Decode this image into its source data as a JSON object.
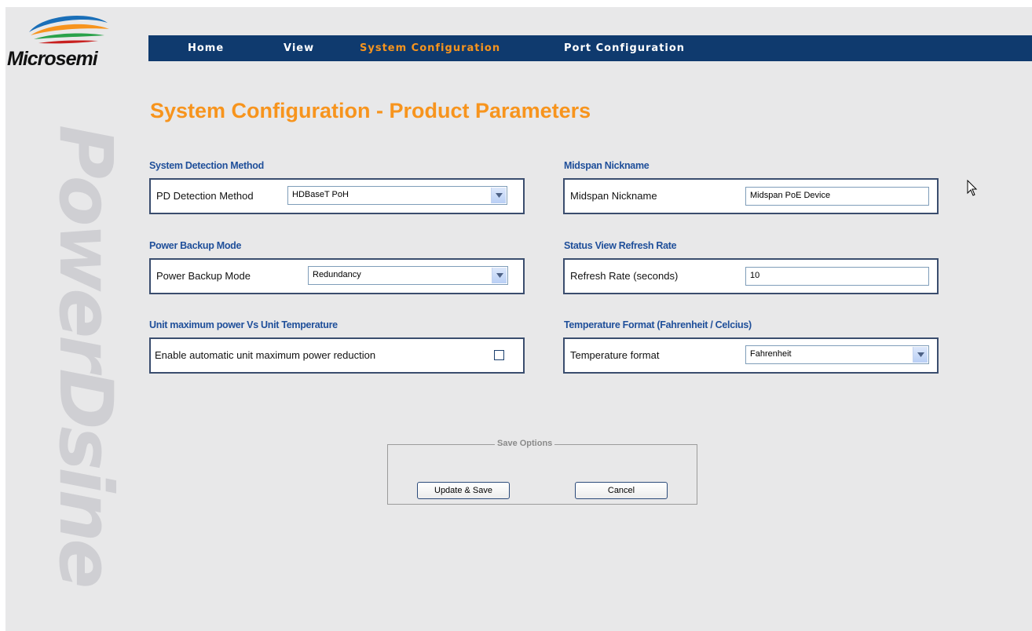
{
  "brand": {
    "logo_text": "Microsemi",
    "watermark": "PowerDsine"
  },
  "nav": {
    "items": [
      {
        "label": "Home",
        "active": false
      },
      {
        "label": "View",
        "active": false
      },
      {
        "label": "System Configuration",
        "active": true
      },
      {
        "label": "Port Configuration",
        "active": false
      }
    ]
  },
  "page": {
    "title": "System Configuration - Product Parameters"
  },
  "sections": {
    "detection": {
      "heading": "System Detection Method",
      "field_label": "PD Detection Method",
      "selected": "HDBaseT PoH"
    },
    "nickname": {
      "heading": "Midspan Nickname",
      "field_label": "Midspan Nickname",
      "value": "Midspan PoE Device"
    },
    "backup": {
      "heading": "Power Backup Mode",
      "field_label": "Power Backup Mode",
      "selected": "Redundancy"
    },
    "refresh": {
      "heading": "Status View Refresh Rate",
      "field_label": "Refresh Rate (seconds)",
      "value": "10"
    },
    "power_temp": {
      "heading": "Unit maximum power Vs Unit Temperature",
      "field_label": "Enable automatic unit maximum power reduction",
      "checked": false
    },
    "temp_format": {
      "heading": "Temperature Format (Fahrenheit / Celcius)",
      "field_label": "Temperature format",
      "selected": "Fahrenheit"
    }
  },
  "save_options": {
    "legend": "Save Options",
    "update_label": "Update & Save",
    "cancel_label": "Cancel"
  },
  "colors": {
    "nav_bg": "#0f3a6e",
    "accent": "#f7941d",
    "heading_blue": "#1f4f9a",
    "page_bg": "#e8e8e9"
  }
}
